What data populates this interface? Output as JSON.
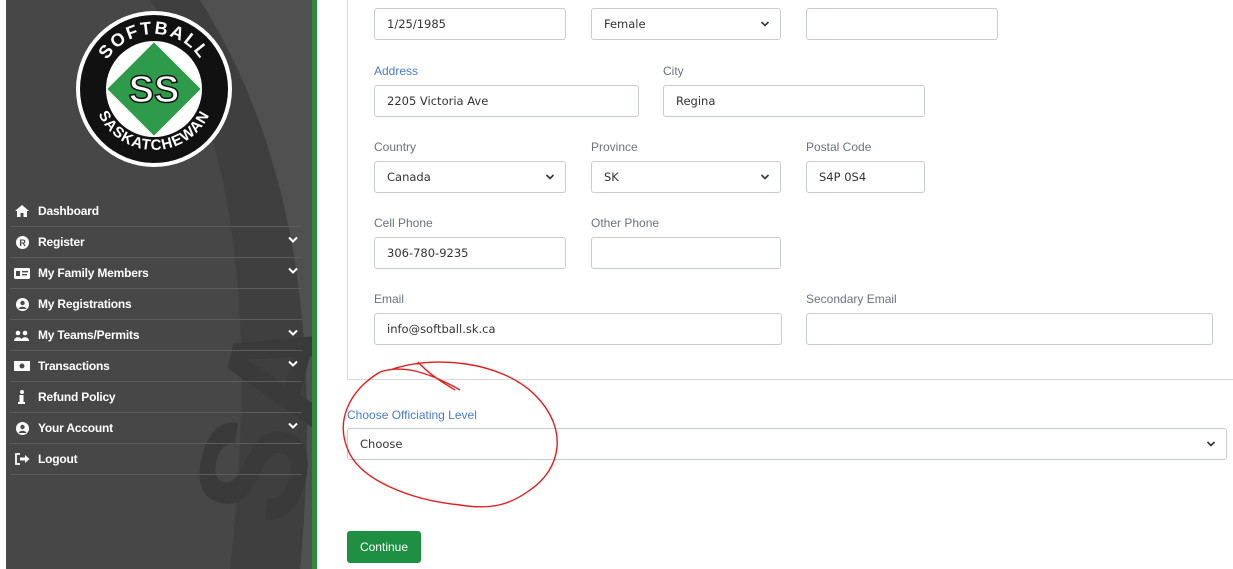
{
  "sidebar": {
    "logo": {
      "top_text": "SOFTBALL",
      "bottom_text": "SASKATCHEWAN",
      "monogram": "SS"
    },
    "watermark": "SA",
    "items": [
      {
        "label": "Dashboard",
        "icon": "home-icon",
        "has_chevron": false
      },
      {
        "label": "Register",
        "icon": "r-circle-icon",
        "has_chevron": true
      },
      {
        "label": "My Family Members",
        "icon": "id-card-icon",
        "has_chevron": true
      },
      {
        "label": "My Registrations",
        "icon": "user-circle-icon",
        "has_chevron": false
      },
      {
        "label": "My Teams/Permits",
        "icon": "users-icon",
        "has_chevron": true
      },
      {
        "label": "Transactions",
        "icon": "money-icon",
        "has_chevron": true
      },
      {
        "label": "Refund Policy",
        "icon": "info-icon",
        "has_chevron": false
      },
      {
        "label": "Your Account",
        "icon": "user-circle-icon",
        "has_chevron": true
      },
      {
        "label": "Logout",
        "icon": "logout-icon",
        "has_chevron": false
      }
    ]
  },
  "form": {
    "dob": {
      "value": "1/25/1985"
    },
    "gender": {
      "value": "Female"
    },
    "extra": {
      "value": ""
    },
    "address": {
      "label": "Address",
      "value": "2205 Victoria Ave"
    },
    "city": {
      "label": "City",
      "value": "Regina"
    },
    "country": {
      "label": "Country",
      "value": "Canada"
    },
    "province": {
      "label": "Province",
      "value": "SK"
    },
    "postal": {
      "label": "Postal Code",
      "value": "S4P 0S4"
    },
    "cell": {
      "label": "Cell Phone",
      "value": "306-780-9235"
    },
    "other_phone": {
      "label": "Other Phone",
      "value": ""
    },
    "email": {
      "label": "Email",
      "value": "info@softball.sk.ca"
    },
    "secondary_email": {
      "label": "Secondary Email",
      "value": ""
    },
    "officiating": {
      "label": "Choose Officiating Level",
      "value": "Choose"
    }
  },
  "continue_label": "Continue",
  "colors": {
    "sidebar_bg": "#4a4a4a",
    "brand_green": "#1f8f43",
    "label_blue": "#4a7cc7",
    "annotation_red": "#e02020"
  }
}
